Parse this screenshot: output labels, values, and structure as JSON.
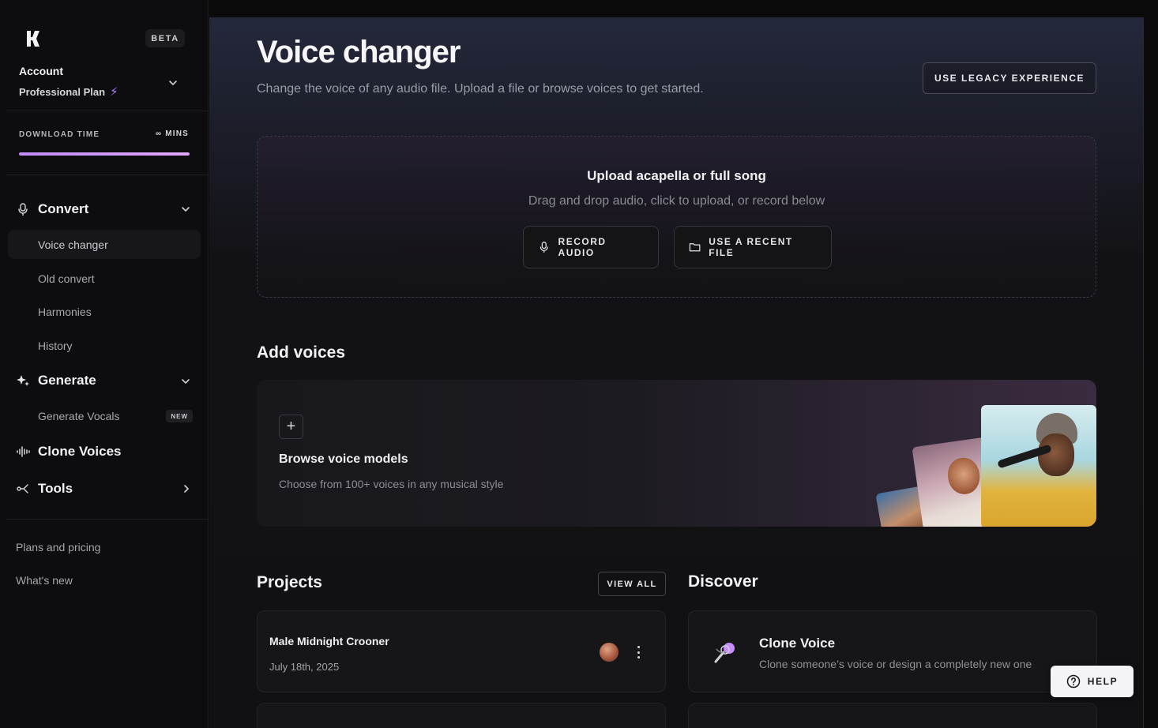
{
  "sidebar": {
    "beta": "BETA",
    "account_label": "Account",
    "plan": "Professional Plan",
    "download_label": "DOWNLOAD TIME",
    "download_value": "∞ MINS",
    "download_progress": 1.0,
    "sections": {
      "convert": "Convert",
      "generate": "Generate",
      "clone": "Clone Voices",
      "tools": "Tools"
    },
    "convert_items": [
      "Voice changer",
      "Old convert",
      "Harmonies",
      "History"
    ],
    "generate_items": [
      "Generate Vocals"
    ],
    "new_badge": "NEW",
    "footer_links": [
      "Plans and pricing",
      "What's new"
    ]
  },
  "header": {
    "title": "Voice changer",
    "subtitle": "Change the voice of any audio file. Upload a file or browse voices to get started.",
    "legacy_button": "USE LEGACY EXPERIENCE"
  },
  "upload": {
    "title": "Upload acapella or full song",
    "subtitle": "Drag and drop audio, click to upload, or record below",
    "record_button": "RECORD AUDIO",
    "recent_button": "USE A RECENT FILE"
  },
  "add_voices": {
    "heading": "Add voices",
    "card_title": "Browse voice models",
    "card_subtitle": "Choose from 100+ voices in any musical style"
  },
  "projects": {
    "heading": "Projects",
    "view_all": "VIEW ALL",
    "items": [
      {
        "name": "Male Midnight Crooner",
        "date": "July 18th, 2025"
      }
    ]
  },
  "discover": {
    "heading": "Discover",
    "items": [
      {
        "title": "Clone Voice",
        "subtitle": "Clone someone’s voice or design a completely new one"
      }
    ]
  },
  "help": {
    "label": "HELP"
  },
  "colors": {
    "accent": "#c28bff",
    "background": "#0b0b0c",
    "card": "#161619"
  }
}
